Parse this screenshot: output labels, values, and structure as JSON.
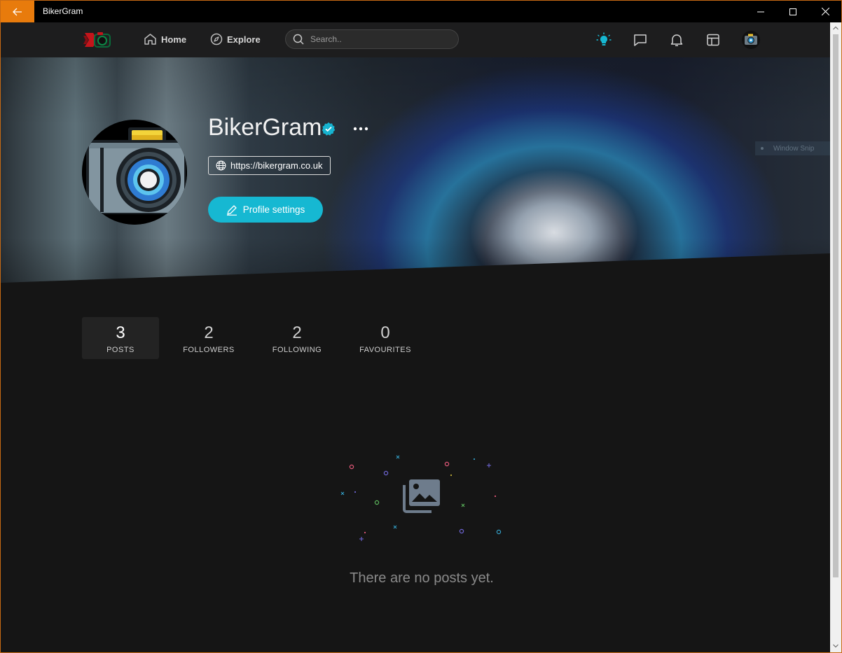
{
  "window": {
    "title": "BikerGram"
  },
  "nav": {
    "home_label": "Home",
    "explore_label": "Explore",
    "search_placeholder": "Search.."
  },
  "profile": {
    "name": "BikerGram",
    "website": "https://bikergram.co.uk",
    "settings_label": "Profile settings",
    "banner_ghost_text": "Window Snip"
  },
  "stats": [
    {
      "value": "3",
      "label": "POSTS"
    },
    {
      "value": "2",
      "label": "FOLLOWERS"
    },
    {
      "value": "2",
      "label": "FOLLOWING"
    },
    {
      "value": "0",
      "label": "FAVOURITES"
    }
  ],
  "empty_state": {
    "message": "There are no posts yet."
  },
  "colors": {
    "accent": "#16b8d2",
    "titlebar_back": "#e87b0c"
  }
}
